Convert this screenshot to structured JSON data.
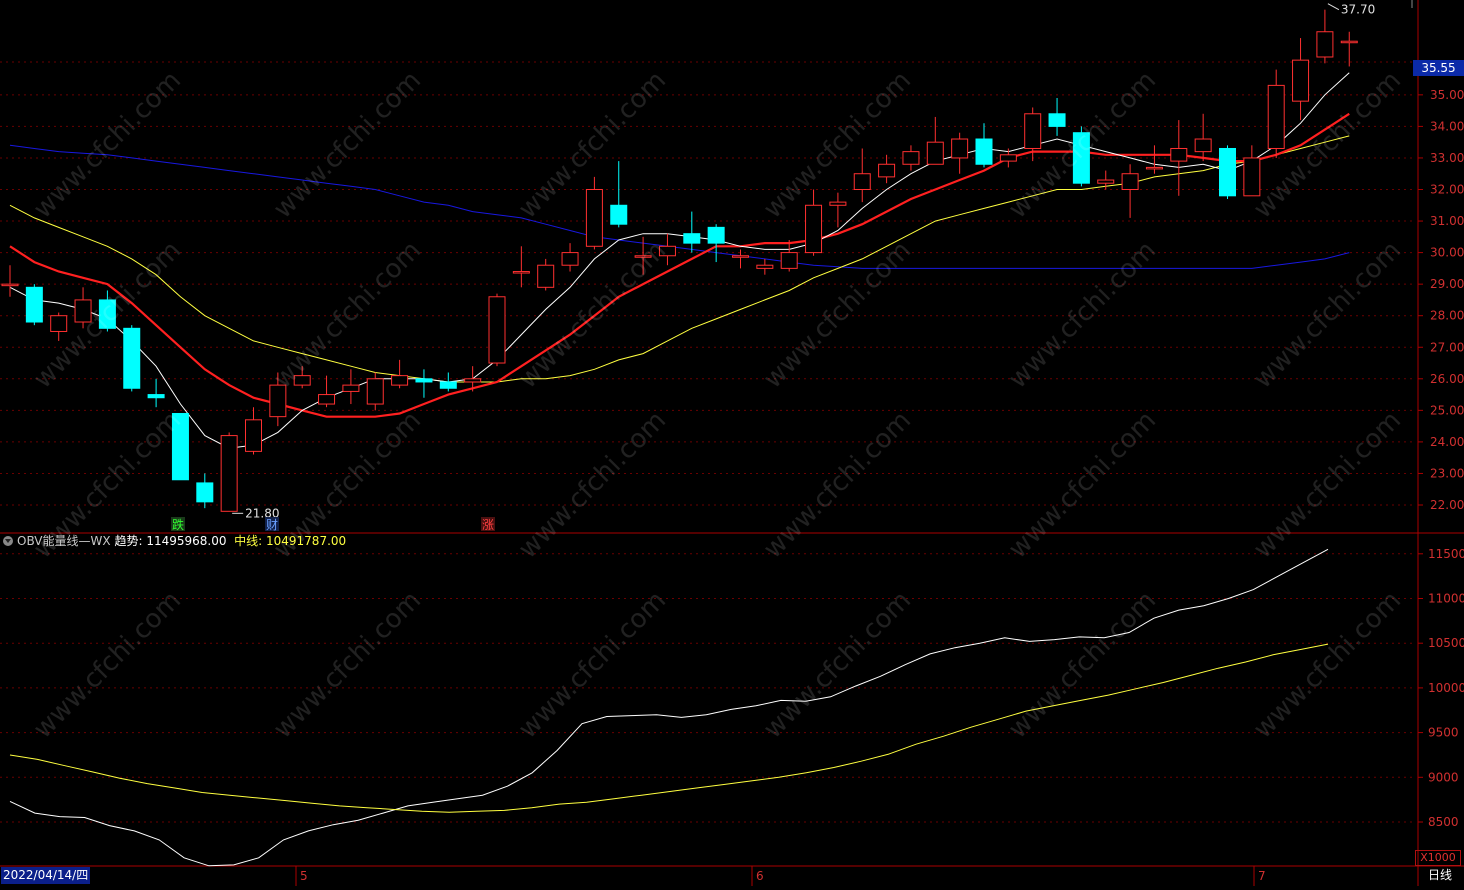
{
  "chart_data": [
    {
      "type": "candlestick",
      "title": "",
      "ylim": [
        21.5,
        38.0
      ],
      "y_ticks": [
        22.0,
        23.0,
        24.0,
        25.0,
        26.0,
        27.0,
        28.0,
        29.0,
        30.0,
        31.0,
        32.0,
        33.0,
        34.0,
        35.0
      ],
      "y_tick_labels": [
        "22.00",
        "23.00",
        "24.00",
        "25.00",
        "26.00",
        "27.00",
        "28.00",
        "29.00",
        "30.00",
        "31.00",
        "32.00",
        "33.00",
        "34.00",
        "35.00"
      ],
      "last_price": "35.55",
      "high_label": "37.70",
      "low_label": "21.80",
      "candles": [
        {
          "o": 29.0,
          "c": 29.0,
          "h": 29.6,
          "l": 28.6
        },
        {
          "o": 28.9,
          "c": 27.8,
          "h": 29.0,
          "l": 27.7
        },
        {
          "o": 27.5,
          "c": 28.0,
          "h": 28.1,
          "l": 27.2
        },
        {
          "o": 27.8,
          "c": 28.5,
          "h": 28.9,
          "l": 27.6
        },
        {
          "o": 28.5,
          "c": 27.6,
          "h": 28.8,
          "l": 27.5
        },
        {
          "o": 27.6,
          "c": 25.7,
          "h": 27.7,
          "l": 25.6
        },
        {
          "o": 25.5,
          "c": 25.4,
          "h": 26.0,
          "l": 25.1
        },
        {
          "o": 24.9,
          "c": 22.8,
          "h": 24.9,
          "l": 22.8
        },
        {
          "o": 22.7,
          "c": 22.1,
          "h": 23.0,
          "l": 21.9
        },
        {
          "o": 21.8,
          "c": 24.2,
          "h": 24.3,
          "l": 21.8
        },
        {
          "o": 23.7,
          "c": 24.7,
          "h": 25.1,
          "l": 23.6
        },
        {
          "o": 24.8,
          "c": 25.8,
          "h": 26.2,
          "l": 24.5
        },
        {
          "o": 25.8,
          "c": 26.1,
          "h": 26.4,
          "l": 25.7
        },
        {
          "o": 25.2,
          "c": 25.5,
          "h": 26.1,
          "l": 25.1
        },
        {
          "o": 25.6,
          "c": 25.8,
          "h": 26.3,
          "l": 25.2
        },
        {
          "o": 25.2,
          "c": 26.0,
          "h": 26.2,
          "l": 25.0
        },
        {
          "o": 25.8,
          "c": 26.1,
          "h": 26.6,
          "l": 25.7
        },
        {
          "o": 26.0,
          "c": 25.9,
          "h": 26.3,
          "l": 25.4
        },
        {
          "o": 25.9,
          "c": 25.7,
          "h": 26.2,
          "l": 25.6
        },
        {
          "o": 25.9,
          "c": 26.0,
          "h": 26.4,
          "l": 25.6
        },
        {
          "o": 26.5,
          "c": 28.6,
          "h": 28.7,
          "l": 26.4
        },
        {
          "o": 29.4,
          "c": 29.4,
          "h": 30.2,
          "l": 28.9
        },
        {
          "o": 28.9,
          "c": 29.6,
          "h": 29.8,
          "l": 28.8
        },
        {
          "o": 29.6,
          "c": 30.0,
          "h": 30.3,
          "l": 29.4
        },
        {
          "o": 30.2,
          "c": 32.0,
          "h": 32.4,
          "l": 30.1
        },
        {
          "o": 31.5,
          "c": 30.9,
          "h": 32.9,
          "l": 30.8
        },
        {
          "o": 29.9,
          "c": 29.9,
          "h": 30.5,
          "l": 29.3
        },
        {
          "o": 29.9,
          "c": 30.2,
          "h": 30.6,
          "l": 29.6
        },
        {
          "o": 30.6,
          "c": 30.3,
          "h": 31.3,
          "l": 30.0
        },
        {
          "o": 30.8,
          "c": 30.3,
          "h": 30.9,
          "l": 29.7
        },
        {
          "o": 29.9,
          "c": 29.9,
          "h": 30.1,
          "l": 29.5
        },
        {
          "o": 29.5,
          "c": 29.6,
          "h": 29.8,
          "l": 29.3
        },
        {
          "o": 29.5,
          "c": 30.0,
          "h": 30.4,
          "l": 29.4
        },
        {
          "o": 30.0,
          "c": 31.5,
          "h": 32.0,
          "l": 29.9
        },
        {
          "o": 31.5,
          "c": 31.6,
          "h": 31.9,
          "l": 30.8
        },
        {
          "o": 32.0,
          "c": 32.5,
          "h": 33.3,
          "l": 31.6
        },
        {
          "o": 32.4,
          "c": 32.8,
          "h": 33.1,
          "l": 32.2
        },
        {
          "o": 32.8,
          "c": 33.2,
          "h": 33.4,
          "l": 32.6
        },
        {
          "o": 32.8,
          "c": 33.5,
          "h": 34.3,
          "l": 32.8
        },
        {
          "o": 33.0,
          "c": 33.6,
          "h": 33.8,
          "l": 32.5
        },
        {
          "o": 33.6,
          "c": 32.8,
          "h": 34.1,
          "l": 32.7
        },
        {
          "o": 32.9,
          "c": 33.1,
          "h": 33.3,
          "l": 32.7
        },
        {
          "o": 33.3,
          "c": 34.4,
          "h": 34.6,
          "l": 32.9
        },
        {
          "o": 34.4,
          "c": 34.0,
          "h": 34.9,
          "l": 33.7
        },
        {
          "o": 33.8,
          "c": 32.2,
          "h": 34.0,
          "l": 32.1
        },
        {
          "o": 32.2,
          "c": 32.3,
          "h": 32.6,
          "l": 32.0
        },
        {
          "o": 32.0,
          "c": 32.5,
          "h": 32.8,
          "l": 31.1
        },
        {
          "o": 32.7,
          "c": 32.7,
          "h": 33.4,
          "l": 32.5
        },
        {
          "o": 32.9,
          "c": 33.3,
          "h": 34.2,
          "l": 31.8
        },
        {
          "o": 33.2,
          "c": 33.6,
          "h": 34.4,
          "l": 32.9
        },
        {
          "o": 33.3,
          "c": 31.8,
          "h": 33.4,
          "l": 31.7
        },
        {
          "o": 31.8,
          "c": 33.0,
          "h": 33.4,
          "l": 31.8
        },
        {
          "o": 33.3,
          "c": 35.3,
          "h": 35.8,
          "l": 33.0
        },
        {
          "o": 34.8,
          "c": 36.1,
          "h": 36.8,
          "l": 34.2
        },
        {
          "o": 36.2,
          "c": 37.0,
          "h": 37.7,
          "l": 36.0
        },
        {
          "o": 36.7,
          "c": 36.7,
          "h": 37.0,
          "l": 35.9
        }
      ],
      "series": [
        {
          "name": "",
          "color": "#ffffff",
          "values": [
            28.9,
            28.5,
            28.4,
            28.2,
            27.9,
            27.2,
            26.4,
            25.2,
            24.2,
            23.8,
            23.9,
            24.3,
            25.0,
            25.4,
            25.7,
            26.0,
            26.0,
            26.0,
            25.9,
            26.0,
            26.6,
            27.4,
            28.2,
            28.9,
            29.8,
            30.4,
            30.6,
            30.6,
            30.5,
            30.4,
            30.2,
            30.1,
            30.1,
            30.3,
            30.7,
            31.4,
            32.0,
            32.5,
            32.9,
            33.1,
            33.3,
            33.2,
            33.4,
            33.6,
            33.4,
            33.2,
            33.0,
            32.8,
            32.7,
            32.8,
            32.6,
            32.9,
            33.4,
            34.1,
            35.0,
            35.7
          ]
        },
        {
          "name": "",
          "color": "#ff2020",
          "values": [
            30.2,
            29.7,
            29.4,
            29.2,
            29.0,
            28.4,
            27.7,
            27.0,
            26.3,
            25.8,
            25.4,
            25.2,
            25.0,
            24.8,
            24.8,
            24.8,
            24.9,
            25.2,
            25.5,
            25.7,
            25.9,
            26.4,
            26.9,
            27.4,
            28.0,
            28.6,
            29.0,
            29.4,
            29.8,
            30.2,
            30.2,
            30.3,
            30.3,
            30.4,
            30.6,
            30.9,
            31.3,
            31.7,
            32.0,
            32.3,
            32.6,
            33.0,
            33.2,
            33.2,
            33.2,
            33.1,
            33.1,
            33.1,
            33.1,
            33.0,
            32.9,
            32.9,
            33.1,
            33.4,
            33.9,
            34.4
          ]
        },
        {
          "name": "",
          "color": "#ffff40",
          "values": [
            31.5,
            31.1,
            30.8,
            30.5,
            30.2,
            29.8,
            29.3,
            28.6,
            28.0,
            27.6,
            27.2,
            27.0,
            26.8,
            26.6,
            26.4,
            26.2,
            26.1,
            26.0,
            25.9,
            25.9,
            25.9,
            26.0,
            26.0,
            26.1,
            26.3,
            26.6,
            26.8,
            27.2,
            27.6,
            27.9,
            28.2,
            28.5,
            28.8,
            29.2,
            29.5,
            29.8,
            30.2,
            30.6,
            31.0,
            31.2,
            31.4,
            31.6,
            31.8,
            32.0,
            32.0,
            32.1,
            32.2,
            32.4,
            32.5,
            32.6,
            32.8,
            32.9,
            33.1,
            33.3,
            33.5,
            33.7
          ]
        },
        {
          "name": "",
          "color": "#1818e0",
          "values": [
            33.4,
            33.3,
            33.2,
            33.15,
            33.1,
            33.0,
            32.9,
            32.8,
            32.7,
            32.6,
            32.5,
            32.4,
            32.3,
            32.2,
            32.1,
            32.0,
            31.8,
            31.6,
            31.5,
            31.3,
            31.2,
            31.1,
            30.9,
            30.7,
            30.5,
            30.4,
            30.3,
            30.2,
            30.1,
            30.0,
            29.9,
            29.8,
            29.7,
            29.6,
            29.55,
            29.5,
            29.5,
            29.5,
            29.5,
            29.5,
            29.5,
            29.5,
            29.5,
            29.5,
            29.5,
            29.5,
            29.5,
            29.5,
            29.5,
            29.5,
            29.5,
            29.5,
            29.6,
            29.7,
            29.8,
            30.0
          ]
        }
      ]
    },
    {
      "type": "line",
      "title": "OBV能量线—WX",
      "ylim": [
        8000,
        11800
      ],
      "y_ticks": [
        8500,
        9000,
        9500,
        10000,
        10500,
        11000,
        11500
      ],
      "y_tick_labels": [
        "8500",
        "9000",
        "9500",
        "10000",
        "10500",
        "11000",
        "11500"
      ],
      "scale_label": "X1000",
      "series": [
        {
          "name": "趋势",
          "color": "#ffffff",
          "values": [
            8730,
            8600,
            8560,
            8550,
            8460,
            8400,
            8300,
            8100,
            8010,
            8020,
            8100,
            8300,
            8400,
            8470,
            8520,
            8600,
            8680,
            8720,
            8760,
            8800,
            8900,
            9050,
            9300,
            9600,
            9680,
            9690,
            9700,
            9670,
            9700,
            9760,
            9800,
            9860,
            9850,
            9900,
            10020,
            10130,
            10260,
            10380,
            10450,
            10500,
            10560,
            10520,
            10540,
            10570,
            10560,
            10620,
            10780,
            10870,
            10920,
            11000,
            11100,
            11250,
            11400,
            11550
          ]
        },
        {
          "name": "中线",
          "color": "#ffff40",
          "values": [
            9250,
            9200,
            9130,
            9060,
            8990,
            8930,
            8880,
            8830,
            8800,
            8770,
            8740,
            8710,
            8680,
            8660,
            8640,
            8620,
            8610,
            8620,
            8630,
            8660,
            8700,
            8720,
            8760,
            8800,
            8840,
            8880,
            8920,
            8960,
            9000,
            9050,
            9110,
            9180,
            9260,
            9370,
            9460,
            9560,
            9650,
            9740,
            9800,
            9860,
            9920,
            9990,
            10060,
            10140,
            10220,
            10290,
            10370,
            10430,
            10490
          ]
        }
      ],
      "legend_values": {
        "trend_label": "趋势:",
        "trend_value": "11495968.00",
        "mid_label": "中线:",
        "mid_value": "10491787.00"
      }
    }
  ],
  "markers": [
    {
      "text": "跌",
      "color": "#30ff30",
      "bg": "#1a3a1a"
    },
    {
      "text": "财",
      "color": "#6aa0ff",
      "bg": "#10204a"
    },
    {
      "text": "涨",
      "color": "#ff4040",
      "bg": "#4a1010"
    }
  ],
  "obv_title": "OBV能量线—WX",
  "x_axis": {
    "date_label": "2022/04/14/四",
    "month_labels": [
      "5",
      "6",
      "7"
    ],
    "period_label": "日线"
  },
  "watermark": "www.cfchi.com",
  "colors": {
    "up": "#ff3030",
    "down": "#00ffff",
    "grid": "#6a0000",
    "axis": "#aa0000"
  }
}
